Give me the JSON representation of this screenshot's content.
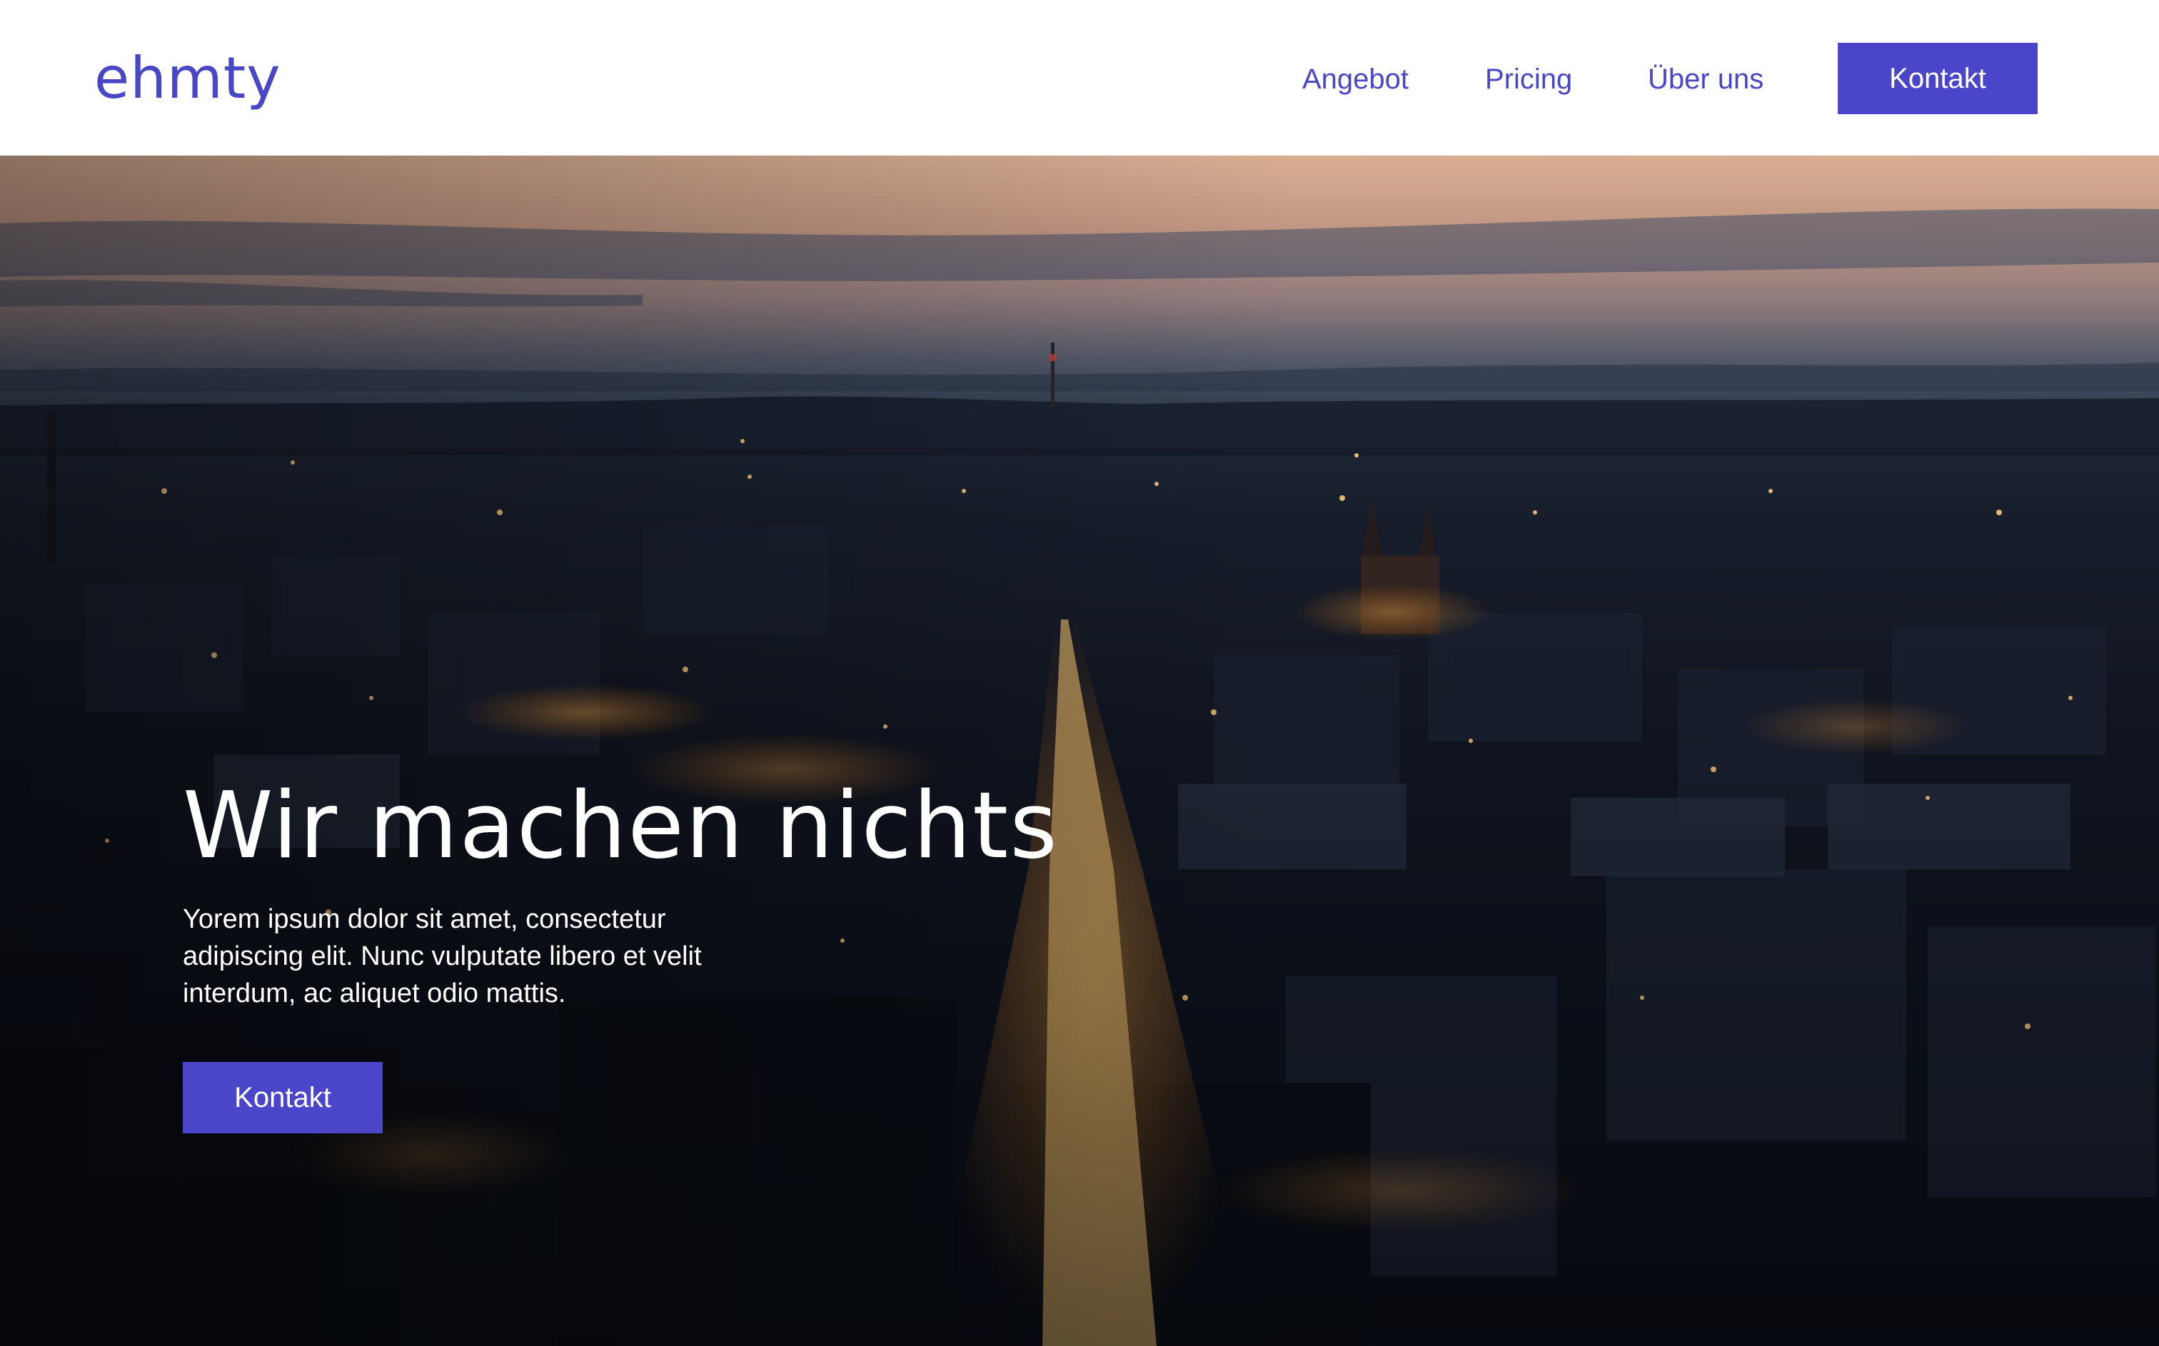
{
  "header": {
    "logo": "ehmty",
    "nav": [
      {
        "label": "Angebot"
      },
      {
        "label": "Pricing"
      },
      {
        "label": "Über uns"
      }
    ],
    "cta_label": "Kontakt"
  },
  "hero": {
    "title": "Wir machen nichts",
    "text": "Yorem ipsum dolor sit amet, consectetur adipiscing elit. Nunc vulputate libero et velit interdum, ac aliquet odio mattis.",
    "cta_label": "Kontakt",
    "background": "aerial-city-dusk-photo"
  },
  "colors": {
    "brand": "#4b45c9",
    "background": "#ffffff",
    "hero_text": "#ffffff"
  }
}
